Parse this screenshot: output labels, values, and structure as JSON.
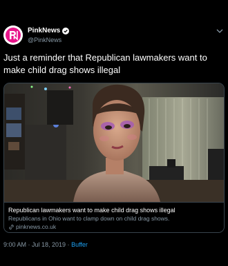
{
  "author": {
    "display_name": "PinkNews",
    "handle": "@PinkNews",
    "avatar_icon": "pinknews-logo-icon",
    "verified_icon": "verified-badge-icon"
  },
  "tweet": {
    "text": "Just a reminder that Republican lawmakers want to make child drag shows illegal"
  },
  "card": {
    "title": "Republican lawmakers want to make child drag shows illegal",
    "description": "Republicans in Ohio want to clamp down on child drag shows.",
    "domain": "pinknews.co.uk",
    "link_icon": "link-icon"
  },
  "footer": {
    "timestamp": "9:00 AM · Jul 18, 2019 · ",
    "source": "Buffer"
  },
  "colors": {
    "background": "#000000",
    "accent": "#1da1f2",
    "secondary_text": "#8899a6",
    "border": "#38444d",
    "brand_pink": "#e8148a"
  }
}
